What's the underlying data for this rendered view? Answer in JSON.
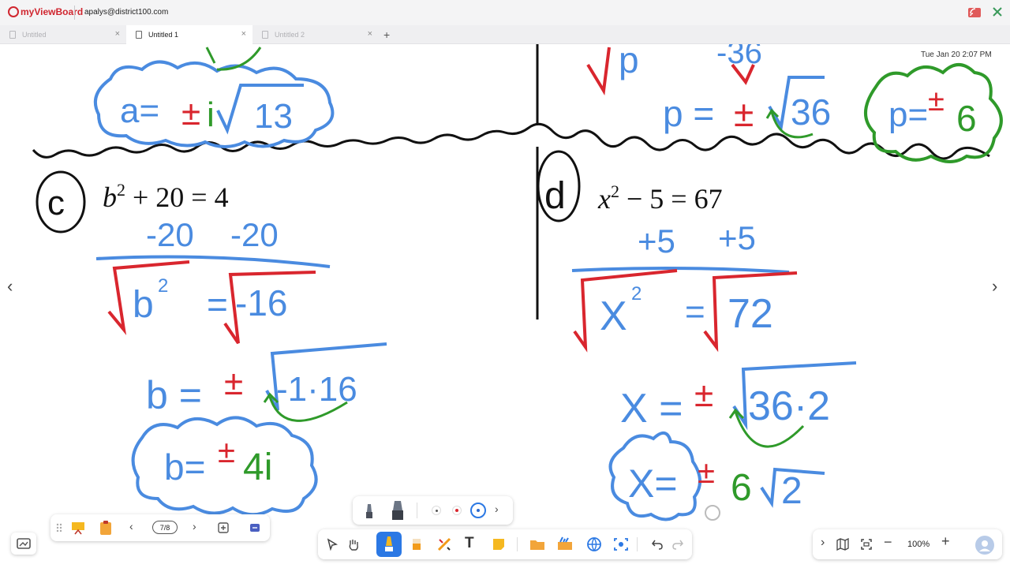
{
  "app": {
    "logo_text": "myViewBoard",
    "account": "apalys@district100.com"
  },
  "tabs": [
    {
      "label": "Untitled",
      "active": false
    },
    {
      "label": "Untitled 1",
      "active": true
    },
    {
      "label": "Untitled 2",
      "active": false
    }
  ],
  "timestamp": "Tue Jan 20 2:07 PM",
  "board": {
    "part_c": {
      "label": "c",
      "equation": {
        "var": "b",
        "exp": "2",
        "rest": " + 20 = 4"
      },
      "ink": [
        "-20",
        "-20",
        "b",
        "2",
        "=",
        "-16",
        "b =",
        "±",
        "-1·16",
        "b=",
        "±",
        "4i"
      ]
    },
    "part_d": {
      "label": "d",
      "equation": {
        "var": "x",
        "exp": "2",
        "rest": " − 5 = 67"
      },
      "ink": [
        "+5",
        "+5",
        "X",
        "2",
        "=",
        "72",
        "X =",
        "±",
        "36·2",
        "X=",
        "±",
        "6",
        "2"
      ]
    },
    "top_left_ink": [
      "a=",
      "±",
      "i",
      "13"
    ],
    "top_right_ink": [
      "p",
      "-36",
      "p =",
      "±",
      "36",
      "p=",
      "±",
      "6"
    ]
  },
  "page_nav": {
    "counter": "7/8"
  },
  "zoom": {
    "level": "100%"
  },
  "colors": {
    "ink_blue": "#4a8be0",
    "ink_red": "#d9262e",
    "ink_green": "#2f9a2a",
    "ink_black": "#111111",
    "accent": "#2b78e4",
    "brand": "#d0262f"
  }
}
